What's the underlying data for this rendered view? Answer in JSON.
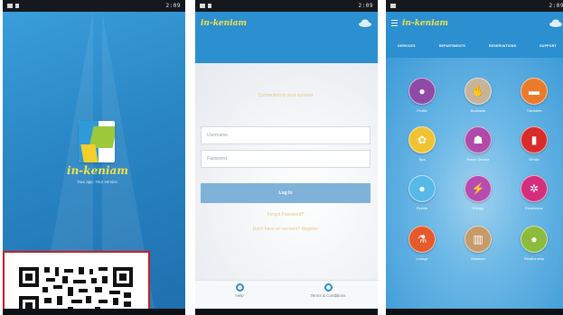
{
  "status_bar": {
    "time": "2:09"
  },
  "splash": {
    "brand": "in-keniam",
    "tagline": "Your app. Your service."
  },
  "login": {
    "brand": "in-keniam",
    "title": "Connection to your account",
    "username_placeholder": "Username",
    "password_placeholder": "Password",
    "login_button": "Log In",
    "forgot_link": "Forgot Password?",
    "register_link": "Don't have an account? Register",
    "footer": {
      "help": "Help",
      "terms": "Terms & Conditions"
    }
  },
  "dashboard": {
    "brand": "in-keniam",
    "tabs": [
      "SERVICES",
      "DEPARTMENTS",
      "RESERVATIONS",
      "SUPPORT"
    ],
    "items": [
      {
        "label": "Profile",
        "color": "#8f4aa8",
        "icon": "person-icon",
        "glyph": "●"
      },
      {
        "label": "Business",
        "color": "#c7b29a",
        "icon": "handshake-icon",
        "glyph": "✋"
      },
      {
        "label": "Transfers",
        "color": "#ea7b2b",
        "icon": "bus-icon",
        "glyph": "▬"
      },
      {
        "label": "Spa",
        "color": "#f1c232",
        "icon": "spa-icon",
        "glyph": "✿"
      },
      {
        "label": "Room Service",
        "color": "#b04aa8",
        "icon": "service-icon",
        "glyph": "☗"
      },
      {
        "label": "Drinks",
        "color": "#d92b2b",
        "icon": "drink-icon",
        "glyph": "▮"
      },
      {
        "label": "Events",
        "color": "#56b9e7",
        "icon": "drop-icon",
        "glyph": "●"
      },
      {
        "label": "Energy",
        "color": "#b64bb0",
        "icon": "energy-icon",
        "glyph": "⚡"
      },
      {
        "label": "Excursions",
        "color": "#d42e7c",
        "icon": "palm-icon",
        "glyph": "✲"
      },
      {
        "label": "Lounge",
        "color": "#e45a2a",
        "icon": "flask-icon",
        "glyph": "⚗"
      },
      {
        "label": "Museum",
        "color": "#c79a6a",
        "icon": "bank-icon",
        "glyph": "▥"
      },
      {
        "label": "Relationship",
        "color": "#8dbb3c",
        "icon": "chat-icon",
        "glyph": "●"
      }
    ]
  },
  "colors": {
    "primary": "#2c8fcf",
    "accent": "#f3e24a",
    "qr_frame": "#c81d25"
  }
}
